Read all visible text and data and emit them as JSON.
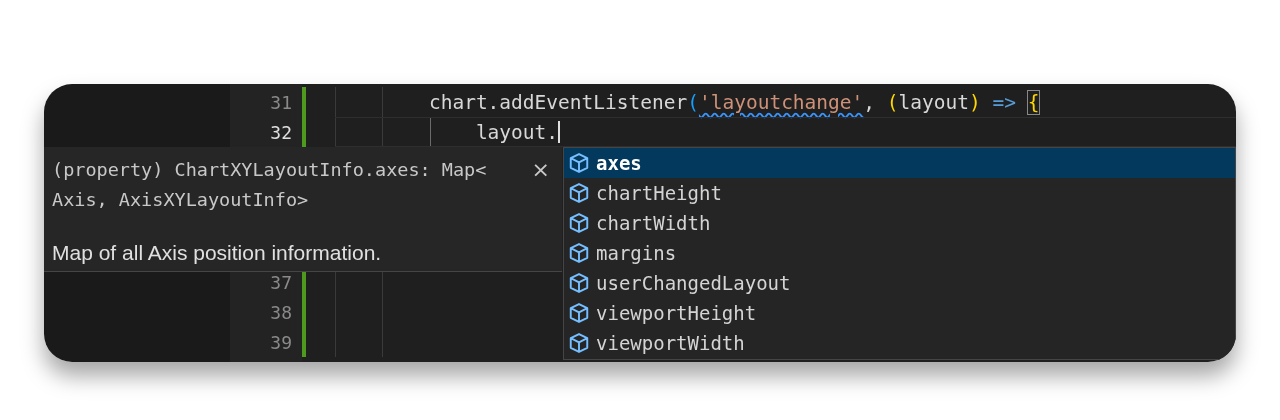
{
  "editor": {
    "lines": [
      {
        "number": "31",
        "current": false,
        "tokens": [
          {
            "text": "        chart.addEventListener",
            "kind": "plain"
          },
          {
            "text": "(",
            "kind": "paren"
          },
          {
            "text": "'layoutchange'",
            "kind": "string",
            "squiggle": true
          },
          {
            "text": ", ",
            "kind": "plain"
          },
          {
            "text": "(",
            "kind": "bracket"
          },
          {
            "text": "layout",
            "kind": "plain"
          },
          {
            "text": ")",
            "kind": "bracket"
          },
          {
            "text": " => ",
            "kind": "keyword"
          },
          {
            "text": "{",
            "kind": "bracket",
            "matched": true
          }
        ]
      },
      {
        "number": "32",
        "current": true,
        "tokens": [
          {
            "text": "            layout.",
            "kind": "plain"
          }
        ]
      },
      {
        "number": "37",
        "current": false
      },
      {
        "number": "38",
        "current": false
      },
      {
        "number": "39",
        "current": false
      }
    ]
  },
  "hover": {
    "signature": [
      "(property) ChartXYLayoutInfo.axes: Map<",
      "Axis, AxisXYLayoutInfo>"
    ],
    "close": "×",
    "description": "Map of all Axis position information."
  },
  "suggestions": [
    {
      "label": "axes",
      "selected": true
    },
    {
      "label": "chartHeight",
      "selected": false
    },
    {
      "label": "chartWidth",
      "selected": false
    },
    {
      "label": "margins",
      "selected": false
    },
    {
      "label": "userChangedLayout",
      "selected": false
    },
    {
      "label": "viewportHeight",
      "selected": false
    },
    {
      "label": "viewportWidth",
      "selected": false
    }
  ]
}
